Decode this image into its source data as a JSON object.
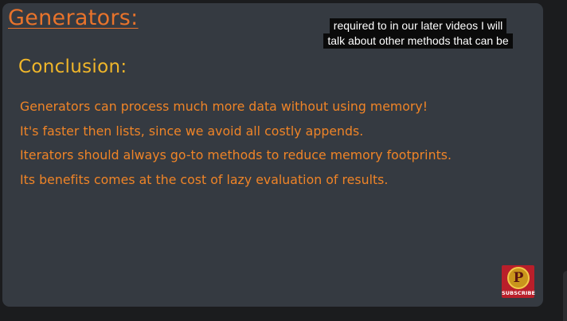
{
  "slide": {
    "title": "Generators:",
    "section_heading": "Conclusion:",
    "bullets": [
      "Generators can process much more data without using memory!",
      "It's faster then lists, since we avoid all costly appends.",
      "Iterators should always go-to methods to reduce memory footprints.",
      "Its benefits comes at the cost of lazy evaluation of results."
    ]
  },
  "caption": {
    "line1": "required to in our later videos I will",
    "line2": "talk about other methods that can be"
  },
  "subscribe_badge": {
    "logo_letter": "P",
    "label": "SUBSCRIBE"
  },
  "colors": {
    "slide_background": "#353a41",
    "title": "#e8732b",
    "heading": "#f0b62a",
    "bullet_text": "#ef8427",
    "badge": "#b91f2a"
  }
}
